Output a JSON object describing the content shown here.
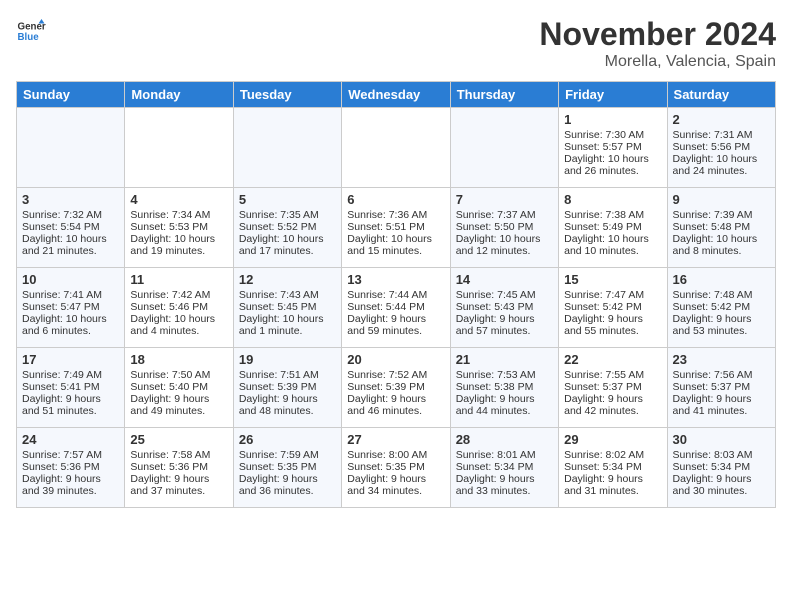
{
  "header": {
    "logo_line1": "General",
    "logo_line2": "Blue",
    "title": "November 2024",
    "subtitle": "Morella, Valencia, Spain"
  },
  "days_of_week": [
    "Sunday",
    "Monday",
    "Tuesday",
    "Wednesday",
    "Thursday",
    "Friday",
    "Saturday"
  ],
  "weeks": [
    [
      {
        "day": "",
        "info": ""
      },
      {
        "day": "",
        "info": ""
      },
      {
        "day": "",
        "info": ""
      },
      {
        "day": "",
        "info": ""
      },
      {
        "day": "",
        "info": ""
      },
      {
        "day": "1",
        "info": "Sunrise: 7:30 AM\nSunset: 5:57 PM\nDaylight: 10 hours and 26 minutes."
      },
      {
        "day": "2",
        "info": "Sunrise: 7:31 AM\nSunset: 5:56 PM\nDaylight: 10 hours and 24 minutes."
      }
    ],
    [
      {
        "day": "3",
        "info": "Sunrise: 7:32 AM\nSunset: 5:54 PM\nDaylight: 10 hours and 21 minutes."
      },
      {
        "day": "4",
        "info": "Sunrise: 7:34 AM\nSunset: 5:53 PM\nDaylight: 10 hours and 19 minutes."
      },
      {
        "day": "5",
        "info": "Sunrise: 7:35 AM\nSunset: 5:52 PM\nDaylight: 10 hours and 17 minutes."
      },
      {
        "day": "6",
        "info": "Sunrise: 7:36 AM\nSunset: 5:51 PM\nDaylight: 10 hours and 15 minutes."
      },
      {
        "day": "7",
        "info": "Sunrise: 7:37 AM\nSunset: 5:50 PM\nDaylight: 10 hours and 12 minutes."
      },
      {
        "day": "8",
        "info": "Sunrise: 7:38 AM\nSunset: 5:49 PM\nDaylight: 10 hours and 10 minutes."
      },
      {
        "day": "9",
        "info": "Sunrise: 7:39 AM\nSunset: 5:48 PM\nDaylight: 10 hours and 8 minutes."
      }
    ],
    [
      {
        "day": "10",
        "info": "Sunrise: 7:41 AM\nSunset: 5:47 PM\nDaylight: 10 hours and 6 minutes."
      },
      {
        "day": "11",
        "info": "Sunrise: 7:42 AM\nSunset: 5:46 PM\nDaylight: 10 hours and 4 minutes."
      },
      {
        "day": "12",
        "info": "Sunrise: 7:43 AM\nSunset: 5:45 PM\nDaylight: 10 hours and 1 minute."
      },
      {
        "day": "13",
        "info": "Sunrise: 7:44 AM\nSunset: 5:44 PM\nDaylight: 9 hours and 59 minutes."
      },
      {
        "day": "14",
        "info": "Sunrise: 7:45 AM\nSunset: 5:43 PM\nDaylight: 9 hours and 57 minutes."
      },
      {
        "day": "15",
        "info": "Sunrise: 7:47 AM\nSunset: 5:42 PM\nDaylight: 9 hours and 55 minutes."
      },
      {
        "day": "16",
        "info": "Sunrise: 7:48 AM\nSunset: 5:42 PM\nDaylight: 9 hours and 53 minutes."
      }
    ],
    [
      {
        "day": "17",
        "info": "Sunrise: 7:49 AM\nSunset: 5:41 PM\nDaylight: 9 hours and 51 minutes."
      },
      {
        "day": "18",
        "info": "Sunrise: 7:50 AM\nSunset: 5:40 PM\nDaylight: 9 hours and 49 minutes."
      },
      {
        "day": "19",
        "info": "Sunrise: 7:51 AM\nSunset: 5:39 PM\nDaylight: 9 hours and 48 minutes."
      },
      {
        "day": "20",
        "info": "Sunrise: 7:52 AM\nSunset: 5:39 PM\nDaylight: 9 hours and 46 minutes."
      },
      {
        "day": "21",
        "info": "Sunrise: 7:53 AM\nSunset: 5:38 PM\nDaylight: 9 hours and 44 minutes."
      },
      {
        "day": "22",
        "info": "Sunrise: 7:55 AM\nSunset: 5:37 PM\nDaylight: 9 hours and 42 minutes."
      },
      {
        "day": "23",
        "info": "Sunrise: 7:56 AM\nSunset: 5:37 PM\nDaylight: 9 hours and 41 minutes."
      }
    ],
    [
      {
        "day": "24",
        "info": "Sunrise: 7:57 AM\nSunset: 5:36 PM\nDaylight: 9 hours and 39 minutes."
      },
      {
        "day": "25",
        "info": "Sunrise: 7:58 AM\nSunset: 5:36 PM\nDaylight: 9 hours and 37 minutes."
      },
      {
        "day": "26",
        "info": "Sunrise: 7:59 AM\nSunset: 5:35 PM\nDaylight: 9 hours and 36 minutes."
      },
      {
        "day": "27",
        "info": "Sunrise: 8:00 AM\nSunset: 5:35 PM\nDaylight: 9 hours and 34 minutes."
      },
      {
        "day": "28",
        "info": "Sunrise: 8:01 AM\nSunset: 5:34 PM\nDaylight: 9 hours and 33 minutes."
      },
      {
        "day": "29",
        "info": "Sunrise: 8:02 AM\nSunset: 5:34 PM\nDaylight: 9 hours and 31 minutes."
      },
      {
        "day": "30",
        "info": "Sunrise: 8:03 AM\nSunset: 5:34 PM\nDaylight: 9 hours and 30 minutes."
      }
    ]
  ]
}
